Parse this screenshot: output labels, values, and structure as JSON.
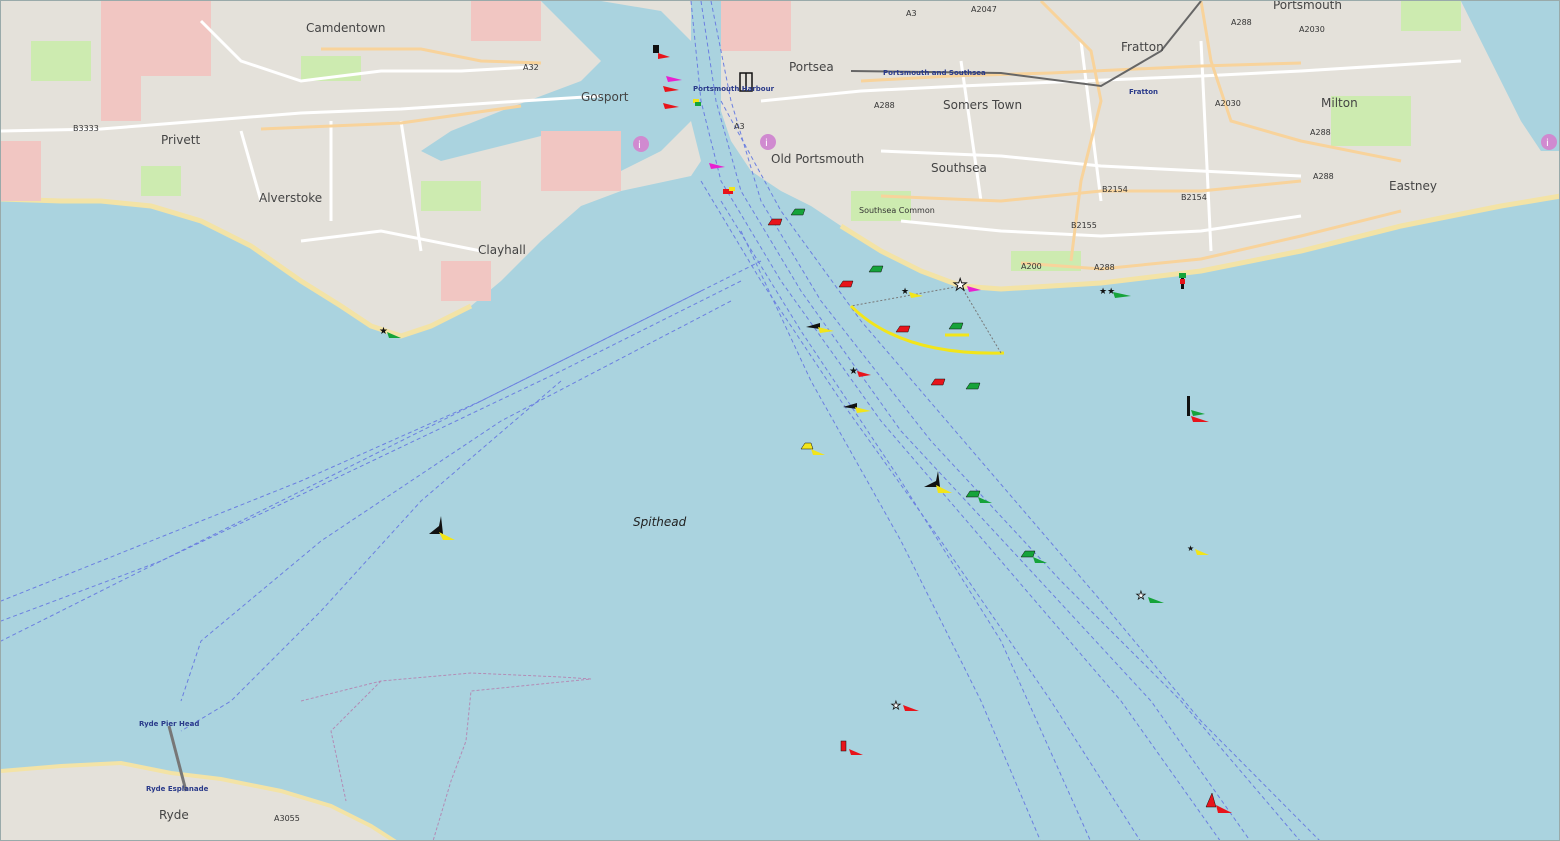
{
  "map": {
    "sea_label": "Spithead",
    "places": [
      {
        "id": "camdentown",
        "label": "Camdentown"
      },
      {
        "id": "portsmouth",
        "label": "Portsmouth"
      },
      {
        "id": "fratton",
        "label": "Fratton"
      },
      {
        "id": "gosport",
        "label": "Gosport"
      },
      {
        "id": "portsea",
        "label": "Portsea"
      },
      {
        "id": "somers-town",
        "label": "Somers Town"
      },
      {
        "id": "milton",
        "label": "Milton"
      },
      {
        "id": "privett",
        "label": "Privett"
      },
      {
        "id": "old-portsmouth",
        "label": "Old Portsmouth"
      },
      {
        "id": "southsea",
        "label": "Southsea"
      },
      {
        "id": "alverstoke",
        "label": "Alverstoke"
      },
      {
        "id": "eastney",
        "label": "Eastney"
      },
      {
        "id": "clayhall",
        "label": "Clayhall"
      },
      {
        "id": "ryde",
        "label": "Ryde"
      },
      {
        "id": "southsea-common",
        "label": "Southsea Common"
      }
    ],
    "roads": [
      {
        "id": "a32",
        "label": "A32"
      },
      {
        "id": "a3",
        "label": "A3"
      },
      {
        "id": "a2047",
        "label": "A2047"
      },
      {
        "id": "a288-top",
        "label": "A288"
      },
      {
        "id": "a2030",
        "label": "A2030"
      },
      {
        "id": "b3333",
        "label": "B3333"
      },
      {
        "id": "a288",
        "label": "A288"
      },
      {
        "id": "a3-south",
        "label": "A3"
      },
      {
        "id": "a2030-b",
        "label": "A2030"
      },
      {
        "id": "a288-b",
        "label": "A288"
      },
      {
        "id": "b2154",
        "label": "B2154"
      },
      {
        "id": "b2154-b",
        "label": "B2154"
      },
      {
        "id": "b2155",
        "label": "B2155"
      },
      {
        "id": "a288-c",
        "label": "A288"
      },
      {
        "id": "a200",
        "label": "A200"
      },
      {
        "id": "a288-d",
        "label": "A288"
      },
      {
        "id": "a3055",
        "label": "A3055"
      }
    ],
    "piers": [
      {
        "id": "portsmouth-harbour",
        "label": "Portsmouth Harbour"
      },
      {
        "id": "portsmouth-southsea",
        "label": "Portsmouth and Southsea"
      },
      {
        "id": "fratton-station",
        "label": "Fratton"
      },
      {
        "id": "ryde-pier-head",
        "label": "Ryde Pier Head"
      },
      {
        "id": "ryde-esplanade",
        "label": "Ryde Esplanade"
      }
    ],
    "buoy_colors": {
      "red": "#e8141b",
      "green": "#16a33a",
      "yellow": "#f2e51a",
      "magenta": "#e820d0",
      "black": "#111111"
    },
    "icons": [
      "buoy-icon",
      "beacon-icon",
      "light-star-icon",
      "information-icon",
      "anchor-icon"
    ]
  }
}
